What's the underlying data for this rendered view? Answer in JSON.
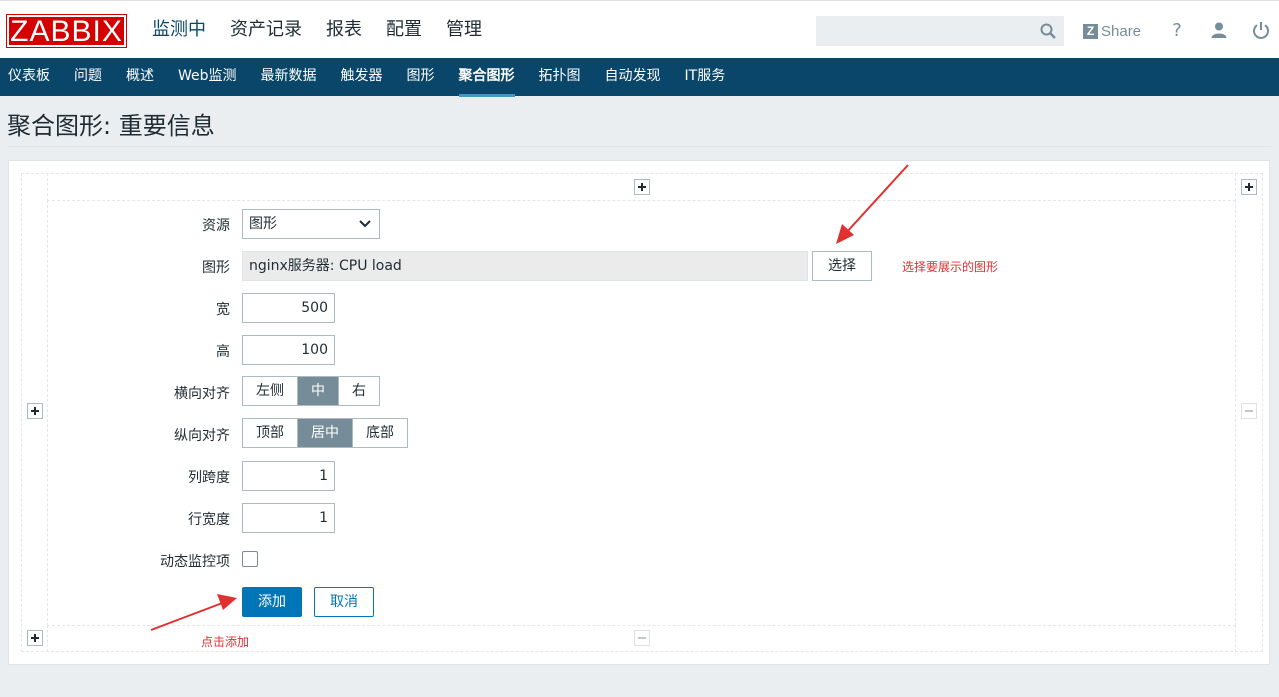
{
  "header": {
    "logo": "ZABBIX",
    "nav": [
      "监测中",
      "资产记录",
      "报表",
      "配置",
      "管理"
    ],
    "active_nav": "监测中",
    "search_placeholder": "",
    "share_label": "Share",
    "share_icon": "zabbix-z-icon",
    "icons": [
      "search-icon",
      "help-icon",
      "user-icon",
      "power-icon"
    ]
  },
  "subnav": {
    "items": [
      "仪表板",
      "问题",
      "概述",
      "Web监测",
      "最新数据",
      "触发器",
      "图形",
      "聚合图形",
      "拓扑图",
      "自动发现",
      "IT服务"
    ],
    "active": "聚合图形"
  },
  "page": {
    "title": "聚合图形: 重要信息"
  },
  "form": {
    "resource": {
      "label": "资源",
      "value": "图形"
    },
    "graph": {
      "label": "图形",
      "value": "nginx服务器: CPU load",
      "select_label": "选择"
    },
    "width": {
      "label": "宽",
      "value": "500"
    },
    "height": {
      "label": "高",
      "value": "100"
    },
    "halign": {
      "label": "横向对齐",
      "options": [
        "左侧",
        "中",
        "右"
      ],
      "selected": "中"
    },
    "valign": {
      "label": "纵向对齐",
      "options": [
        "顶部",
        "居中",
        "底部"
      ],
      "selected": "居中"
    },
    "colspan": {
      "label": "列跨度",
      "value": "1"
    },
    "rowspan": {
      "label": "行宽度",
      "value": "1"
    },
    "dynamic": {
      "label": "动态监控项",
      "checked": false
    },
    "add_label": "添加",
    "cancel_label": "取消"
  },
  "annotations": {
    "select_note": "选择要展示的图形",
    "add_note": "点击添加"
  },
  "colors": {
    "brand": "#d40000",
    "subnav_bg": "#0a466a",
    "primary": "#0275b8",
    "segment_on": "#768d99",
    "annotation": "#e03030"
  }
}
